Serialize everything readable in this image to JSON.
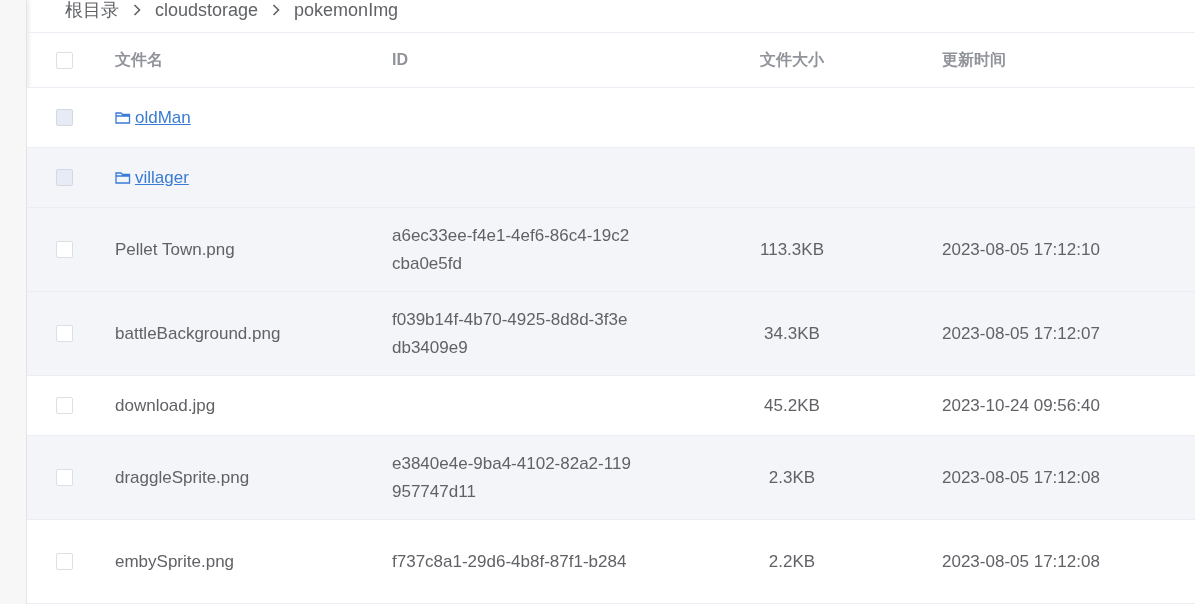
{
  "breadcrumb": [
    "根目录",
    "cloudstorage",
    "pokemonImg"
  ],
  "table": {
    "columns": [
      "文件名",
      "ID",
      "文件大小",
      "更新时间"
    ],
    "select_all": {
      "checked": false
    },
    "rows": [
      {
        "kind": "folder",
        "name": "oldMan",
        "id": "",
        "size": "",
        "updated": "",
        "checked": false,
        "disabled": true,
        "highlighted": false
      },
      {
        "kind": "folder",
        "name": "villager",
        "id": "",
        "size": "",
        "updated": "",
        "checked": false,
        "disabled": true,
        "highlighted": true
      },
      {
        "kind": "file",
        "name": "Pellet Town.png",
        "id": "a6ec33ee-f4e1-4ef6-86c4-19c2cba0e5fd",
        "size": "113.3KB",
        "updated": "2023-08-05 17:12:10",
        "checked": false,
        "disabled": false,
        "highlighted": true
      },
      {
        "kind": "file",
        "name": "battleBackground.png",
        "id": "f039b14f-4b70-4925-8d8d-3f3edb3409e9",
        "size": "34.3KB",
        "updated": "2023-08-05 17:12:07",
        "checked": false,
        "disabled": false,
        "highlighted": true
      },
      {
        "kind": "file",
        "name": "download.jpg",
        "id": "",
        "size": "45.2KB",
        "updated": "2023-10-24 09:56:40",
        "checked": false,
        "disabled": false,
        "highlighted": false
      },
      {
        "kind": "file",
        "name": "draggleSprite.png",
        "id": "e3840e4e-9ba4-4102-82a2-119957747d11",
        "size": "2.3KB",
        "updated": "2023-08-05 17:12:08",
        "checked": false,
        "disabled": false,
        "highlighted": true
      },
      {
        "kind": "file",
        "name": "embySprite.png",
        "id": "f737c8a1-29d6-4b8f-87f1-b284",
        "size": "2.2KB",
        "updated": "2023-08-05 17:12:08",
        "checked": false,
        "disabled": false,
        "highlighted": false
      }
    ]
  }
}
